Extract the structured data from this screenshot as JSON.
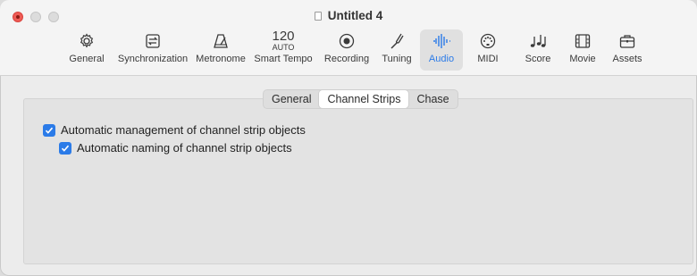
{
  "window": {
    "title": "Untitled 4"
  },
  "toolbar": {
    "items": [
      {
        "label": "General",
        "icon": "gear-icon"
      },
      {
        "label": "Synchronization",
        "icon": "sync-icon"
      },
      {
        "label": "Metronome",
        "icon": "metronome-icon"
      },
      {
        "label": "Smart Tempo",
        "icon": "tempo-icon",
        "tempo_value": "120",
        "tempo_mode": "AUTO"
      },
      {
        "label": "Recording",
        "icon": "record-icon"
      },
      {
        "label": "Tuning",
        "icon": "tuning-fork-icon"
      },
      {
        "label": "Audio",
        "icon": "waveform-icon",
        "active": true
      },
      {
        "label": "MIDI",
        "icon": "midi-icon"
      },
      {
        "label": "Score",
        "icon": "notes-icon"
      },
      {
        "label": "Movie",
        "icon": "film-icon"
      },
      {
        "label": "Assets",
        "icon": "briefcase-icon"
      }
    ]
  },
  "tabs": {
    "items": [
      {
        "label": "General"
      },
      {
        "label": "Channel Strips",
        "selected": true
      },
      {
        "label": "Chase"
      }
    ]
  },
  "settings": {
    "auto_manage_label": "Automatic management of channel strip objects",
    "auto_manage_checked": true,
    "auto_naming_label": "Automatic naming of channel strip objects",
    "auto_naming_checked": true
  },
  "colors": {
    "accent": "#2b7be8",
    "close": "#ee5b55"
  }
}
